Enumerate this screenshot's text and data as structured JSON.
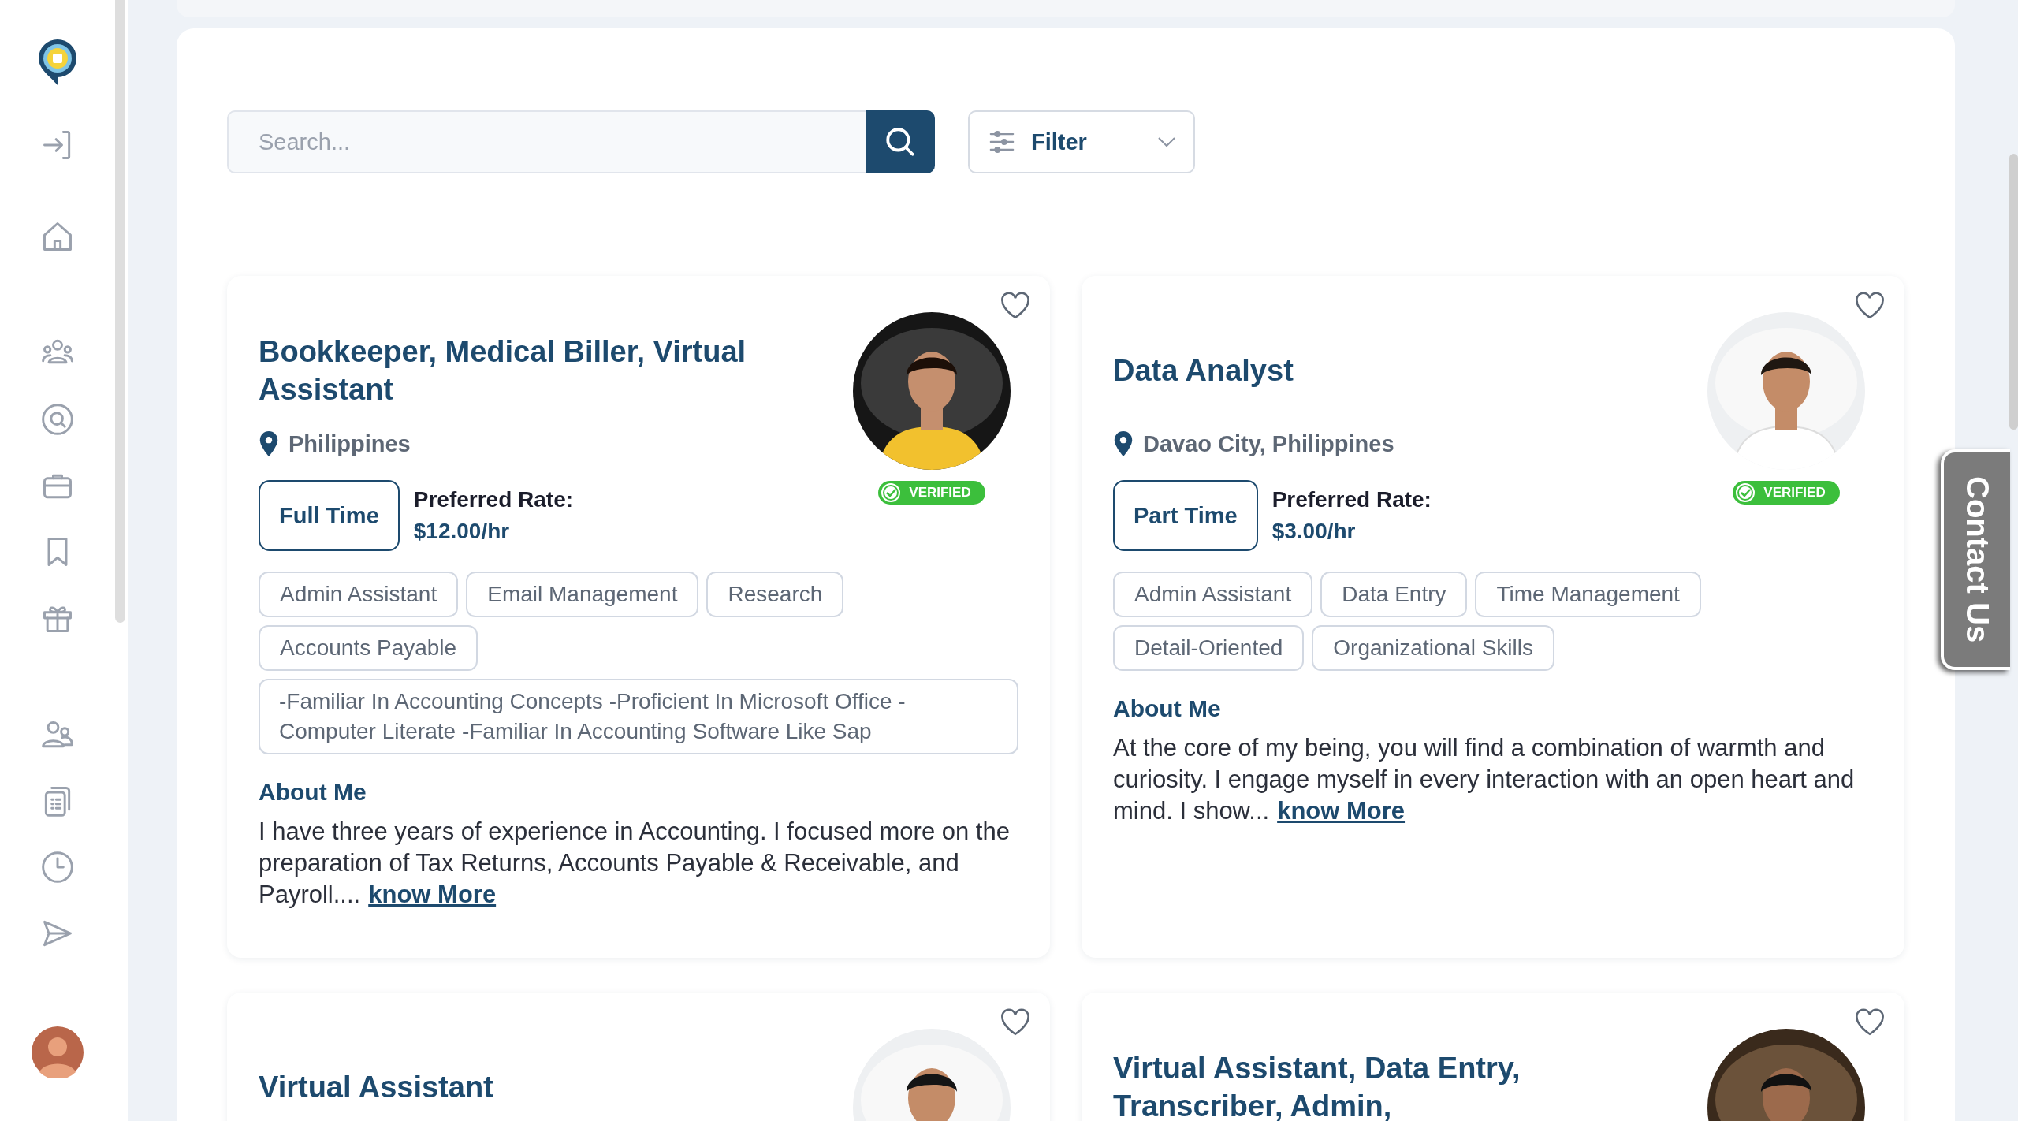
{
  "search": {
    "placeholder": "Search..."
  },
  "filter": {
    "label": "Filter"
  },
  "profiles": [
    {
      "title": "Bookkeeper, Medical Biller, Virtual Assistant",
      "photo": {
        "kind": "picture"
      },
      "location": "Philippines",
      "employment_type": "Full Time",
      "rate_label": "Preferred Rate:",
      "rate": "$12.00/hr",
      "verified": true,
      "verified_label": "VERIFIED",
      "skills": [
        "Admin Assistant",
        "Email Management",
        "Research",
        "Accounts Payable"
      ],
      "summary": "-Familiar In Accounting Concepts -Proficient In Microsoft Office -Computer Literate -Familiar In Accounting Software Like Sap",
      "about_heading": "About Me",
      "about": "I have three years of experience in Accounting. I focused more on the preparation of Tax Returns, Accounts Payable & Receivable, and Payroll....",
      "link": "know More"
    },
    {
      "title": "Data Analyst",
      "photo": {
        "kind": "picture"
      },
      "location": "Davao City, Philippines",
      "employment_type": "Part Time",
      "rate_label": "Preferred Rate:",
      "rate": "$3.00/hr",
      "verified": true,
      "verified_label": "VERIFIED",
      "skills": [
        "Admin Assistant",
        "Data Entry",
        "Time Management",
        "Detail-Oriented",
        "Organizational Skills"
      ],
      "about_heading": "About Me",
      "about": "At the core of my being, you will find a combination of warmth and curiosity. I engage myself in every interaction with an open heart and mind. I show...",
      "link": "know More"
    },
    {
      "title": "Virtual Assistant",
      "photo": {
        "kind": "picture"
      }
    },
    {
      "title": "Virtual Assistant, Data Entry, Transcriber, Admin,",
      "photo": {
        "kind": "picture"
      }
    }
  ],
  "contact_tab": {
    "label": "Contact Us"
  }
}
